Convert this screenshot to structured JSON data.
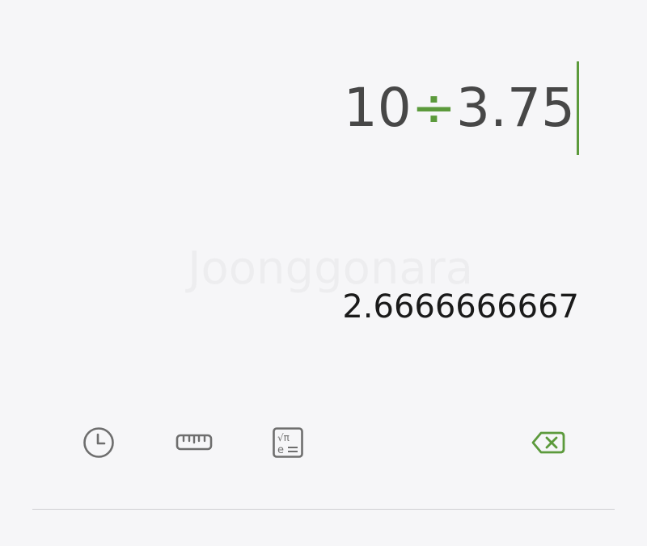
{
  "display": {
    "operand1": "10",
    "operator": "÷",
    "operand2": "3.75",
    "result": "2.6666666667"
  },
  "watermark": "Joonggonara",
  "toolbar": {
    "history_icon": "clock-icon",
    "converter_icon": "ruler-icon",
    "scientific_icon": "scientific-calculator-icon",
    "backspace_icon": "backspace-icon"
  },
  "colors": {
    "background": "#f6f6f8",
    "accent": "#5c9a3c",
    "expression_text": "#474747",
    "result_text": "#1a1a1a",
    "icon_gray": "#6e6e6e",
    "divider": "#cfcfd3"
  }
}
